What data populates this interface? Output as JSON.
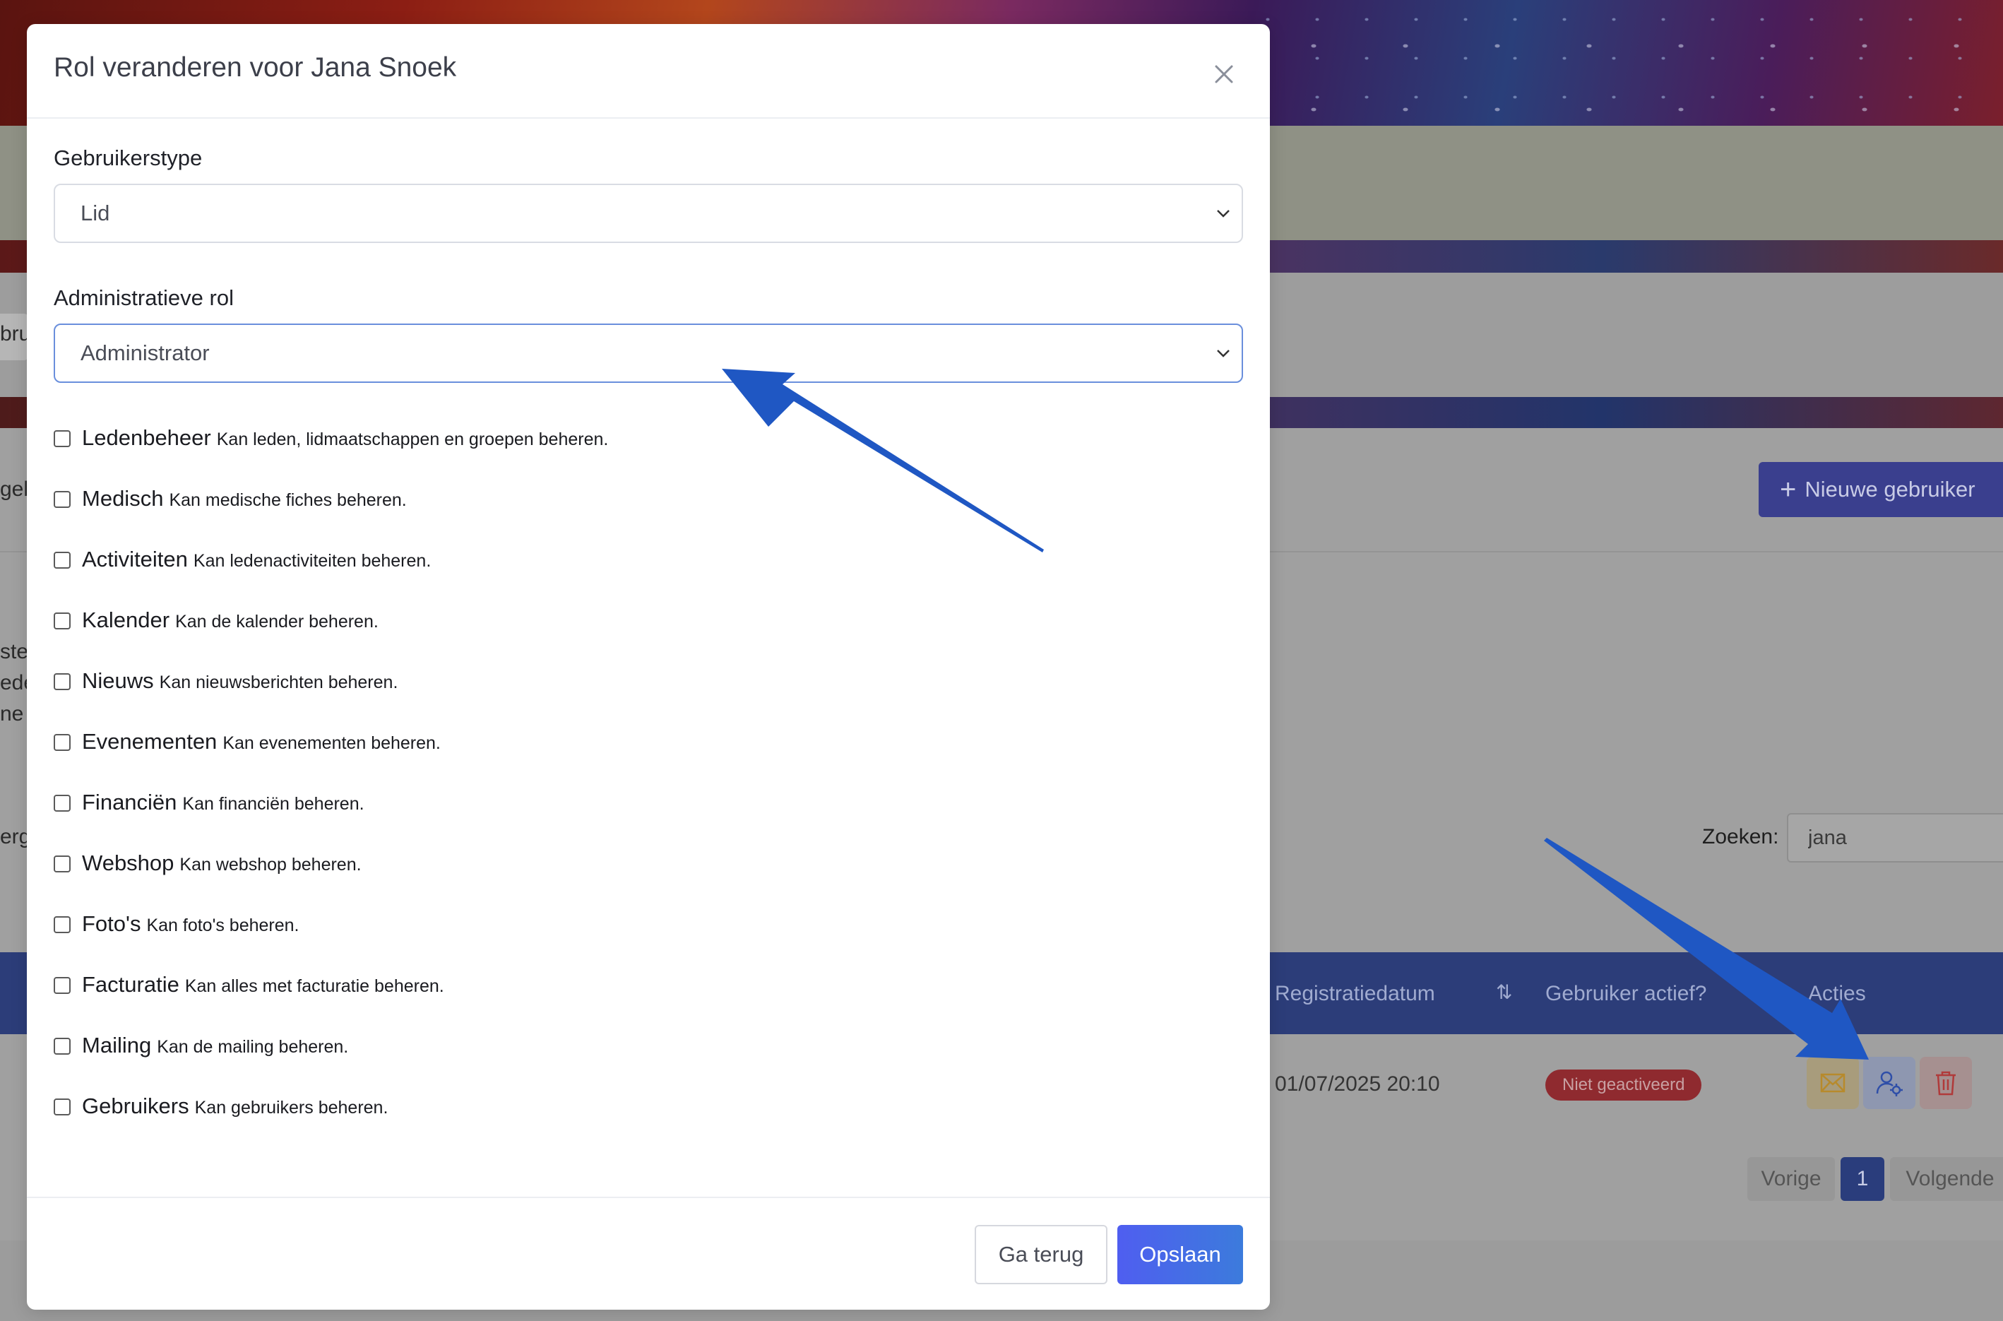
{
  "modal": {
    "title": "Rol veranderen voor Jana Snoek",
    "user_type": {
      "label": "Gebruikerstype",
      "value": "Lid"
    },
    "admin_role": {
      "label": "Administratieve rol",
      "value": "Administrator"
    },
    "permissions": [
      {
        "name": "Ledenbeheer",
        "description": "Kan leden, lidmaatschappen en groepen beheren."
      },
      {
        "name": "Medisch",
        "description": "Kan medische fiches beheren."
      },
      {
        "name": "Activiteiten",
        "description": "Kan ledenactiviteiten beheren."
      },
      {
        "name": "Kalender",
        "description": "Kan de kalender beheren."
      },
      {
        "name": "Nieuws",
        "description": "Kan nieuwsberichten beheren."
      },
      {
        "name": "Evenementen",
        "description": "Kan evenementen beheren."
      },
      {
        "name": "Financiën",
        "description": "Kan financiën beheren."
      },
      {
        "name": "Webshop",
        "description": "Kan webshop beheren."
      },
      {
        "name": "Foto's",
        "description": "Kan foto's beheren."
      },
      {
        "name": "Facturatie",
        "description": "Kan alles met facturatie beheren."
      },
      {
        "name": "Mailing",
        "description": "Kan de mailing beheren."
      },
      {
        "name": "Gebruikers",
        "description": "Kan gebruikers beheren."
      }
    ],
    "back_label": "Ga terug",
    "save_label": "Opslaan"
  },
  "background": {
    "new_user_label": "Nieuwe gebruiker",
    "search_label": "Zoeken:",
    "search_value": "jana",
    "columns": [
      "Registratiedatum",
      "Gebruiker actief?",
      "Acties"
    ],
    "row": {
      "date": "01/07/2025 20:10",
      "status": "Niet geactiveerd"
    },
    "pagination": {
      "prev": "Vorige",
      "page": "1",
      "next": "Volgende"
    },
    "left_fragments": [
      "bru",
      "geb",
      "ste",
      "ede",
      "ne g",
      "erg"
    ]
  },
  "colors": {
    "primary": "#3c7bdc",
    "save_gradient_start": "#4f5ef0",
    "focus_border": "#6a8fdc",
    "annotation_arrow": "#1f57c3",
    "badge_danger": "#8f2a2f"
  },
  "icons": [
    "close-icon",
    "chevron-down-icon",
    "plus-icon",
    "mail-icon",
    "user-role-icon",
    "trash-icon",
    "sort-icon"
  ]
}
